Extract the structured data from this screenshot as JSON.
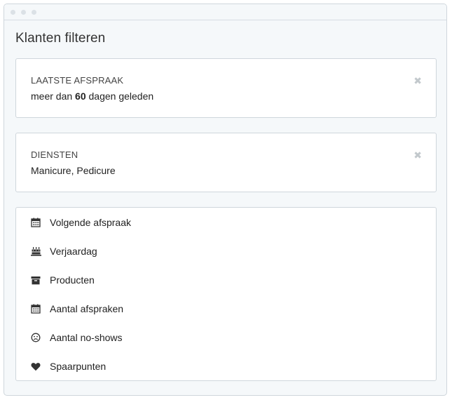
{
  "window": {
    "title_dots": [
      "",
      "",
      ""
    ]
  },
  "page": {
    "title": "Klanten filteren"
  },
  "filters": [
    {
      "heading": "LAATSTE AFSPRAAK",
      "value_prefix": "meer dan ",
      "value_number": "60",
      "value_suffix": " dagen geleden",
      "remove_icon": "close-icon",
      "remove_glyph": "✖"
    },
    {
      "heading": "DIENSTEN",
      "value": "Manicure, Pedicure",
      "remove_icon": "close-icon",
      "remove_glyph": "✖"
    }
  ],
  "options": [
    {
      "label": "Volgende afspraak",
      "icon": "calendar-icon"
    },
    {
      "label": "Verjaardag",
      "icon": "birthday-cake-icon"
    },
    {
      "label": "Producten",
      "icon": "archive-box-icon"
    },
    {
      "label": "Aantal afspraken",
      "icon": "calendar-icon"
    },
    {
      "label": "Aantal no-shows",
      "icon": "frown-face-icon"
    },
    {
      "label": "Spaarpunten",
      "icon": "heart-icon"
    }
  ],
  "colors": {
    "window_background": "#f5f8fa",
    "card_border": "#cfd6dc",
    "remove_icon": "#c2c8cc",
    "icon": "#333333"
  }
}
